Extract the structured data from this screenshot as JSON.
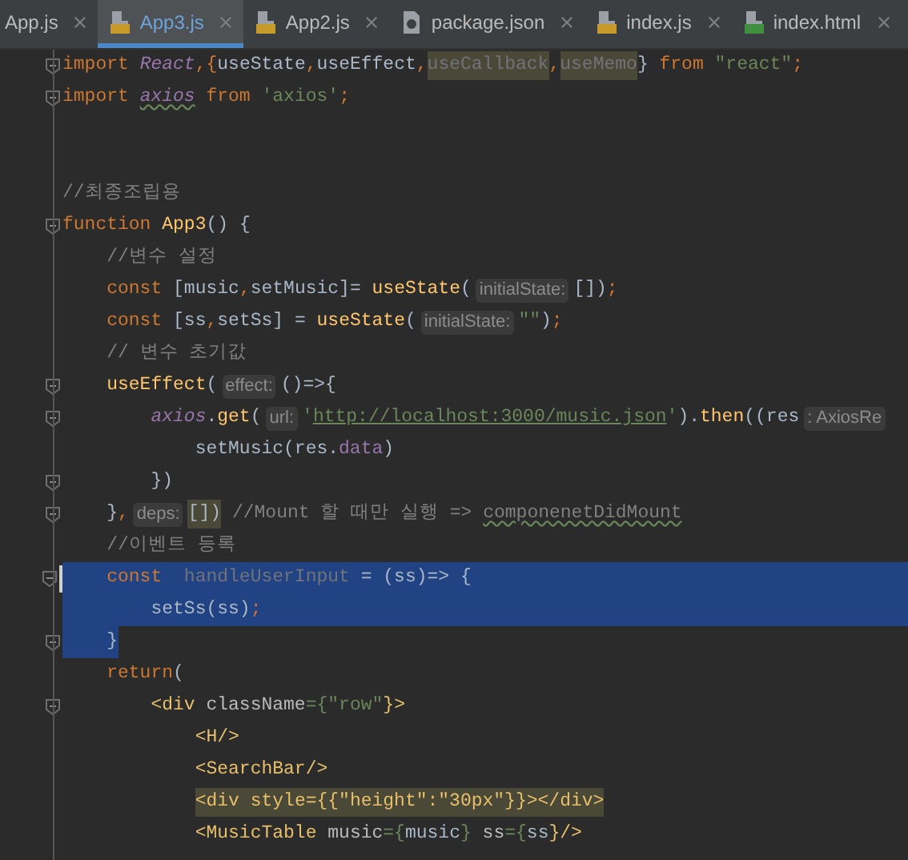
{
  "tabs": [
    {
      "label": "App.js",
      "kind": "plain",
      "selected": false
    },
    {
      "label": "App3.js",
      "kind": "js",
      "selected": true
    },
    {
      "label": "App2.js",
      "kind": "js",
      "selected": false
    },
    {
      "label": "package.json",
      "kind": "json",
      "selected": false
    },
    {
      "label": "index.js",
      "kind": "js",
      "selected": false
    },
    {
      "label": "index.html",
      "kind": "html",
      "selected": false
    }
  ],
  "lines": [
    {
      "fold": true,
      "selected": false,
      "tokens": [
        {
          "t": "import ",
          "kind": "kw"
        },
        {
          "t": "React",
          "kind": "it"
        },
        {
          "t": ",{",
          "kind": "kw"
        },
        {
          "t": "useState",
          "kind": "pl"
        },
        {
          "t": ",",
          "kind": "kw"
        },
        {
          "t": "useEffect",
          "kind": "pl"
        },
        {
          "t": ",",
          "kind": "kw"
        },
        {
          "t": "useCallback",
          "kind": "un",
          "marked": true
        },
        {
          "t": ",",
          "kind": "kw"
        },
        {
          "t": "useMemo",
          "kind": "un",
          "marked": true
        },
        {
          "t": "} ",
          "kind": "pl"
        },
        {
          "t": "from ",
          "kind": "kw"
        },
        {
          "t": "\"react\"",
          "kind": "str"
        },
        {
          "t": ";",
          "kind": "kw"
        }
      ]
    },
    {
      "fold": true,
      "selected": false,
      "tokens": [
        {
          "t": "import ",
          "kind": "kw"
        },
        {
          "t": "axios",
          "kind": "itu"
        },
        {
          "t": " from ",
          "kind": "kw"
        },
        {
          "t": "'axios'",
          "kind": "str"
        },
        {
          "t": ";",
          "kind": "kw"
        }
      ]
    },
    {
      "fold": false,
      "selected": false
    },
    {
      "fold": false,
      "selected": false
    },
    {
      "fold": false,
      "selected": false,
      "tokens": [
        {
          "t": "//최종조립용",
          "kind": "cm"
        }
      ]
    },
    {
      "fold": true,
      "selected": false,
      "tokens": [
        {
          "t": "function ",
          "kind": "kw"
        },
        {
          "t": "App3",
          "kind": "fn"
        },
        {
          "t": "() {",
          "kind": "pl"
        }
      ]
    },
    {
      "fold": false,
      "selected": false,
      "tokens": [
        {
          "t": "    //변수 설정",
          "kind": "cm"
        }
      ]
    },
    {
      "fold": false,
      "selected": false,
      "tokens": [
        {
          "t": "    const ",
          "kind": "kw"
        },
        {
          "t": "[music",
          "kind": "pl"
        },
        {
          "t": ",",
          "kind": "kw"
        },
        {
          "t": "setMusic]= ",
          "kind": "pl"
        },
        {
          "t": "useState",
          "kind": "fn"
        },
        {
          "t": "(",
          "kind": "pl"
        },
        {
          "t": "initialState:",
          "kind": "hint"
        },
        {
          "t": "[])",
          "kind": "pl"
        },
        {
          "t": ";",
          "kind": "kw"
        }
      ]
    },
    {
      "fold": false,
      "selected": false,
      "tokens": [
        {
          "t": "    const ",
          "kind": "kw"
        },
        {
          "t": "[ss",
          "kind": "pl"
        },
        {
          "t": ",",
          "kind": "kw"
        },
        {
          "t": "setSs] = ",
          "kind": "pl"
        },
        {
          "t": "useState",
          "kind": "fn"
        },
        {
          "t": "(",
          "kind": "pl"
        },
        {
          "t": "initialState:",
          "kind": "hint"
        },
        {
          "t": "\"\"",
          "kind": "str"
        },
        {
          "t": ")",
          "kind": "pl"
        },
        {
          "t": ";",
          "kind": "kw"
        }
      ]
    },
    {
      "fold": false,
      "selected": false,
      "tokens": [
        {
          "t": "    // 변수 초기값",
          "kind": "cm"
        }
      ]
    },
    {
      "fold": true,
      "selected": false,
      "tokens": [
        {
          "t": "    useEffect",
          "kind": "fn"
        },
        {
          "t": "(",
          "kind": "pl"
        },
        {
          "t": "effect:",
          "kind": "hint"
        },
        {
          "t": "()=>{",
          "kind": "pl"
        }
      ]
    },
    {
      "fold": true,
      "selected": false,
      "tokens": [
        {
          "t": "        axios",
          "kind": "it"
        },
        {
          "t": ".",
          "kind": "pl"
        },
        {
          "t": "get",
          "kind": "fn"
        },
        {
          "t": "(",
          "kind": "pl"
        },
        {
          "t": "url:",
          "kind": "hint"
        },
        {
          "t": "'",
          "kind": "str"
        },
        {
          "t": "http://localhost:3000/music.json",
          "kind": "url"
        },
        {
          "t": "'",
          "kind": "str"
        },
        {
          "t": ").",
          "kind": "pl"
        },
        {
          "t": "then",
          "kind": "fn"
        },
        {
          "t": "((res",
          "kind": "pl"
        },
        {
          "t": ": AxiosRe",
          "kind": "hint"
        }
      ]
    },
    {
      "fold": false,
      "selected": false,
      "tokens": [
        {
          "t": "            setMusic(res.",
          "kind": "pl"
        },
        {
          "t": "data",
          "kind": "fld"
        },
        {
          "t": ")",
          "kind": "pl"
        }
      ]
    },
    {
      "fold": true,
      "selected": false,
      "tokens": [
        {
          "t": "        })",
          "kind": "pl"
        }
      ]
    },
    {
      "fold": true,
      "selected": false,
      "tokens": [
        {
          "t": "    }",
          "kind": "pl"
        },
        {
          "t": ",",
          "kind": "kw"
        },
        {
          "t": "deps:",
          "kind": "hint"
        },
        {
          "t": "[])",
          "kind": "pl",
          "marked": true
        },
        {
          "t": " //Mount 할 때만 실행 => ",
          "kind": "cm"
        },
        {
          "t": "componenetDidMount",
          "kind": "cmu"
        }
      ]
    },
    {
      "fold": false,
      "selected": false,
      "tokens": [
        {
          "t": "    //이벤트 등록",
          "kind": "cm"
        }
      ]
    },
    {
      "fold": true,
      "selected": true,
      "caret": true,
      "tokens": [
        {
          "t": "    const  ",
          "kind": "kw"
        },
        {
          "t": "handleUserInput",
          "kind": "un"
        },
        {
          "t": " = (ss)=> {",
          "kind": "pl"
        }
      ]
    },
    {
      "fold": false,
      "selected": true,
      "tokens": [
        {
          "t": "        setSs(ss)",
          "kind": "pl"
        },
        {
          "t": ";",
          "kind": "kw"
        }
      ]
    },
    {
      "fold": true,
      "selected": false,
      "tokens": [
        {
          "t": "    }",
          "kind": "pl",
          "selected": true
        }
      ]
    },
    {
      "fold": false,
      "selected": false,
      "tokens": [
        {
          "t": "    return",
          "kind": "kw"
        },
        {
          "t": "(",
          "kind": "pl"
        }
      ]
    },
    {
      "fold": true,
      "selected": false,
      "tokens": [
        {
          "t": "        <div ",
          "kind": "tag"
        },
        {
          "t": "className",
          "kind": "attr"
        },
        {
          "t": "={",
          "kind": "str"
        },
        {
          "t": "\"row\"",
          "kind": "str"
        },
        {
          "t": "}>",
          "kind": "tag"
        }
      ]
    },
    {
      "fold": false,
      "selected": false,
      "tokens": [
        {
          "t": "            <H/>",
          "kind": "tag"
        }
      ]
    },
    {
      "fold": false,
      "selected": false,
      "tokens": [
        {
          "t": "            <SearchBar/>",
          "kind": "tag"
        }
      ]
    },
    {
      "fold": false,
      "selected": false,
      "tokens": [
        {
          "t": "            <div style={{\"height\":\"30px\"}}></div>",
          "kind": "tagline",
          "marked": true
        }
      ]
    },
    {
      "fold": false,
      "selected": false,
      "tokens": [
        {
          "t": "            <MusicTable ",
          "kind": "tag"
        },
        {
          "t": "music",
          "kind": "attr"
        },
        {
          "t": "={",
          "kind": "str"
        },
        {
          "t": "music",
          "kind": "pl"
        },
        {
          "t": "} ",
          "kind": "str"
        },
        {
          "t": "ss",
          "kind": "attr"
        },
        {
          "t": "={",
          "kind": "str"
        },
        {
          "t": "ss",
          "kind": "pl"
        },
        {
          "t": "}/>",
          "kind": "tag"
        }
      ]
    }
  ]
}
